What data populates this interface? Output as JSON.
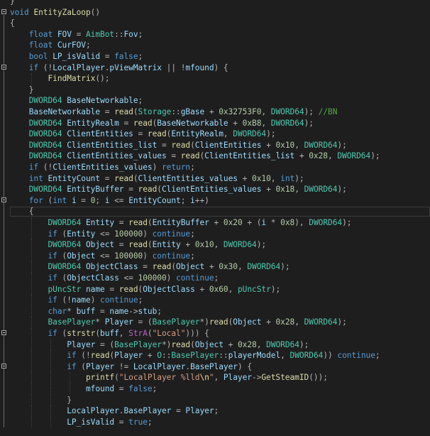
{
  "file_top_brace": "}",
  "lines": [
    [
      [
        "}",
        "op"
      ]
    ],
    [
      [
        "void",
        "kw"
      ],
      [
        " ",
        ""
      ],
      [
        "EntityZaLoop",
        "fn"
      ],
      [
        "()",
        "op"
      ]
    ],
    [
      [
        "{",
        "op"
      ]
    ],
    [
      [
        "    ",
        ""
      ],
      [
        "float",
        "kw"
      ],
      [
        " ",
        ""
      ],
      [
        "FOV",
        "vr"
      ],
      [
        " = ",
        "op"
      ],
      [
        "AimBot",
        "ty"
      ],
      [
        "::",
        "op"
      ],
      [
        "Fov",
        "vr"
      ],
      [
        ";",
        "op"
      ]
    ],
    [
      [
        "    ",
        ""
      ],
      [
        "float",
        "kw"
      ],
      [
        " ",
        ""
      ],
      [
        "CurFOV",
        "vr"
      ],
      [
        ";",
        "op"
      ]
    ],
    [
      [
        "    ",
        ""
      ],
      [
        "bool",
        "kw"
      ],
      [
        " ",
        ""
      ],
      [
        "LP_isValid",
        "vr"
      ],
      [
        " = ",
        "op"
      ],
      [
        "false",
        "kw"
      ],
      [
        ";",
        "op"
      ]
    ],
    [
      [
        "    ",
        ""
      ],
      [
        "if",
        "kw"
      ],
      [
        " (!",
        "op"
      ],
      [
        "LocalPlayer",
        "vr"
      ],
      [
        ".",
        "op"
      ],
      [
        "pViewMatrix",
        "vr"
      ],
      [
        " || !",
        "op"
      ],
      [
        "mfound",
        "vr"
      ],
      [
        ") {",
        "op"
      ]
    ],
    [
      [
        "        ",
        ""
      ],
      [
        "FindMatrix",
        "fn"
      ],
      [
        "();",
        "op"
      ]
    ],
    [
      [
        "    ",
        ""
      ],
      [
        "}",
        "op"
      ]
    ],
    [
      [
        "    ",
        ""
      ],
      [
        "DWORD64",
        "ty"
      ],
      [
        " ",
        ""
      ],
      [
        "BaseNetworkable",
        "vr"
      ],
      [
        ";",
        "op"
      ]
    ],
    [
      [
        "    ",
        ""
      ],
      [
        "BaseNetworkable",
        "vr"
      ],
      [
        " = ",
        "op"
      ],
      [
        "read",
        "fn"
      ],
      [
        "(",
        "op"
      ],
      [
        "Storage",
        "ty"
      ],
      [
        "::",
        "op"
      ],
      [
        "gBase",
        "vr"
      ],
      [
        " + ",
        "op"
      ],
      [
        "0x32753F0",
        "nm"
      ],
      [
        ", ",
        "op"
      ],
      [
        "DWORD64",
        "ty"
      ],
      [
        "); ",
        "op"
      ],
      [
        "//BN",
        "cm"
      ]
    ],
    [
      [
        "    ",
        ""
      ],
      [
        "DWORD64",
        "ty"
      ],
      [
        " ",
        ""
      ],
      [
        "EntityRealm",
        "vr"
      ],
      [
        " = ",
        "op"
      ],
      [
        "read",
        "fn"
      ],
      [
        "(",
        "op"
      ],
      [
        "BaseNetworkable",
        "vr"
      ],
      [
        " + ",
        "op"
      ],
      [
        "0xB8",
        "nm"
      ],
      [
        ", ",
        "op"
      ],
      [
        "DWORD64",
        "ty"
      ],
      [
        ");",
        "op"
      ]
    ],
    [
      [
        "    ",
        ""
      ],
      [
        "DWORD64",
        "ty"
      ],
      [
        " ",
        ""
      ],
      [
        "ClientEntities",
        "vr"
      ],
      [
        " = ",
        "op"
      ],
      [
        "read",
        "fn"
      ],
      [
        "(",
        "op"
      ],
      [
        "EntityRealm",
        "vr"
      ],
      [
        ", ",
        "op"
      ],
      [
        "DWORD64",
        "ty"
      ],
      [
        ");",
        "op"
      ]
    ],
    [
      [
        "    ",
        ""
      ],
      [
        "DWORD64",
        "ty"
      ],
      [
        " ",
        ""
      ],
      [
        "ClientEntities_list",
        "vr"
      ],
      [
        " = ",
        "op"
      ],
      [
        "read",
        "fn"
      ],
      [
        "(",
        "op"
      ],
      [
        "ClientEntities",
        "vr"
      ],
      [
        " + ",
        "op"
      ],
      [
        "0x10",
        "nm"
      ],
      [
        ", ",
        "op"
      ],
      [
        "DWORD64",
        "ty"
      ],
      [
        ");",
        "op"
      ]
    ],
    [
      [
        "    ",
        ""
      ],
      [
        "DWORD64",
        "ty"
      ],
      [
        " ",
        ""
      ],
      [
        "ClientEntities_values",
        "vr"
      ],
      [
        " = ",
        "op"
      ],
      [
        "read",
        "fn"
      ],
      [
        "(",
        "op"
      ],
      [
        "ClientEntities_list",
        "vr"
      ],
      [
        " + ",
        "op"
      ],
      [
        "0x28",
        "nm"
      ],
      [
        ", ",
        "op"
      ],
      [
        "DWORD64",
        "ty"
      ],
      [
        ");",
        "op"
      ]
    ],
    [
      [
        "    ",
        ""
      ],
      [
        "if",
        "kw"
      ],
      [
        " (!",
        "op"
      ],
      [
        "ClientEntities_values",
        "vr"
      ],
      [
        ") ",
        "op"
      ],
      [
        "return",
        "kw"
      ],
      [
        ";",
        "op"
      ]
    ],
    [
      [
        "    ",
        ""
      ],
      [
        "int",
        "kw"
      ],
      [
        " ",
        ""
      ],
      [
        "EntityCount",
        "vr"
      ],
      [
        " = ",
        "op"
      ],
      [
        "read",
        "fn"
      ],
      [
        "(",
        "op"
      ],
      [
        "ClientEntities_values",
        "vr"
      ],
      [
        " + ",
        "op"
      ],
      [
        "0x10",
        "nm"
      ],
      [
        ", ",
        "op"
      ],
      [
        "int",
        "kw"
      ],
      [
        ");",
        "op"
      ]
    ],
    [
      [
        "    ",
        ""
      ],
      [
        "DWORD64",
        "ty"
      ],
      [
        " ",
        ""
      ],
      [
        "EntityBuffer",
        "vr"
      ],
      [
        " = ",
        "op"
      ],
      [
        "read",
        "fn"
      ],
      [
        "(",
        "op"
      ],
      [
        "ClientEntities_values",
        "vr"
      ],
      [
        " + ",
        "op"
      ],
      [
        "0x18",
        "nm"
      ],
      [
        ", ",
        "op"
      ],
      [
        "DWORD64",
        "ty"
      ],
      [
        ");",
        "op"
      ]
    ],
    [
      [
        "    ",
        ""
      ],
      [
        "for",
        "kw"
      ],
      [
        " (",
        "op"
      ],
      [
        "int",
        "kw"
      ],
      [
        " ",
        ""
      ],
      [
        "i",
        "vr"
      ],
      [
        " = ",
        "op"
      ],
      [
        "0",
        "nm"
      ],
      [
        "; ",
        "op"
      ],
      [
        "i",
        "vr"
      ],
      [
        " <= ",
        "op"
      ],
      [
        "EntityCount",
        "vr"
      ],
      [
        "; ",
        "op"
      ],
      [
        "i",
        "vr"
      ],
      [
        "++)",
        "op"
      ]
    ],
    [
      [
        "    ",
        ""
      ],
      [
        "{",
        "op"
      ]
    ],
    [
      [
        "        ",
        ""
      ],
      [
        "DWORD64",
        "ty"
      ],
      [
        " ",
        ""
      ],
      [
        "Entity",
        "vr"
      ],
      [
        " = ",
        "op"
      ],
      [
        "read",
        "fn"
      ],
      [
        "(",
        "op"
      ],
      [
        "EntityBuffer",
        "vr"
      ],
      [
        " + ",
        "op"
      ],
      [
        "0x20",
        "nm"
      ],
      [
        " + (",
        "op"
      ],
      [
        "i",
        "vr"
      ],
      [
        " * ",
        "op"
      ],
      [
        "0x8",
        "nm"
      ],
      [
        "), ",
        "op"
      ],
      [
        "DWORD64",
        "ty"
      ],
      [
        ");",
        "op"
      ]
    ],
    [
      [
        "        ",
        ""
      ],
      [
        "if",
        "kw"
      ],
      [
        " (",
        "op"
      ],
      [
        "Entity",
        "vr"
      ],
      [
        " <= ",
        "op"
      ],
      [
        "100000",
        "nm"
      ],
      [
        ") ",
        "op"
      ],
      [
        "continue",
        "kw"
      ],
      [
        ";",
        "op"
      ]
    ],
    [
      [
        "        ",
        ""
      ],
      [
        "DWORD64",
        "ty"
      ],
      [
        " ",
        ""
      ],
      [
        "Object",
        "vr"
      ],
      [
        " = ",
        "op"
      ],
      [
        "read",
        "fn"
      ],
      [
        "(",
        "op"
      ],
      [
        "Entity",
        "vr"
      ],
      [
        " + ",
        "op"
      ],
      [
        "0x10",
        "nm"
      ],
      [
        ", ",
        "op"
      ],
      [
        "DWORD64",
        "ty"
      ],
      [
        ");",
        "op"
      ]
    ],
    [
      [
        "        ",
        ""
      ],
      [
        "if",
        "kw"
      ],
      [
        " (",
        "op"
      ],
      [
        "Object",
        "vr"
      ],
      [
        " <= ",
        "op"
      ],
      [
        "100000",
        "nm"
      ],
      [
        ") ",
        "op"
      ],
      [
        "continue",
        "kw"
      ],
      [
        ";",
        "op"
      ]
    ],
    [
      [
        "        ",
        ""
      ],
      [
        "DWORD64",
        "ty"
      ],
      [
        " ",
        ""
      ],
      [
        "ObjectClass",
        "vr"
      ],
      [
        " = ",
        "op"
      ],
      [
        "read",
        "fn"
      ],
      [
        "(",
        "op"
      ],
      [
        "Object",
        "vr"
      ],
      [
        " + ",
        "op"
      ],
      [
        "0x30",
        "nm"
      ],
      [
        ", ",
        "op"
      ],
      [
        "DWORD64",
        "ty"
      ],
      [
        ");",
        "op"
      ]
    ],
    [
      [
        "        ",
        ""
      ],
      [
        "if",
        "kw"
      ],
      [
        " (",
        "op"
      ],
      [
        "ObjectClass",
        "vr"
      ],
      [
        " <= ",
        "op"
      ],
      [
        "100000",
        "nm"
      ],
      [
        ") ",
        "op"
      ],
      [
        "continue",
        "kw"
      ],
      [
        ";",
        "op"
      ]
    ],
    [
      [
        "        ",
        ""
      ],
      [
        "pUncStr",
        "ty"
      ],
      [
        " ",
        ""
      ],
      [
        "name",
        "vr"
      ],
      [
        " = ",
        "op"
      ],
      [
        "read",
        "fn"
      ],
      [
        "(",
        "op"
      ],
      [
        "ObjectClass",
        "vr"
      ],
      [
        " + ",
        "op"
      ],
      [
        "0x60",
        "nm"
      ],
      [
        ", ",
        "op"
      ],
      [
        "pUncStr",
        "ty"
      ],
      [
        ");",
        "op"
      ]
    ],
    [
      [
        "        ",
        ""
      ],
      [
        "if",
        "kw"
      ],
      [
        " (!",
        "op"
      ],
      [
        "name",
        "vr"
      ],
      [
        ") ",
        "op"
      ],
      [
        "continue",
        "kw"
      ],
      [
        ";",
        "op"
      ]
    ],
    [
      [
        "        ",
        ""
      ],
      [
        "char",
        "kw"
      ],
      [
        "* ",
        "op"
      ],
      [
        "buff",
        "vr"
      ],
      [
        " = ",
        "op"
      ],
      [
        "name",
        "vr"
      ],
      [
        "->",
        "op"
      ],
      [
        "stub",
        "vr"
      ],
      [
        ";",
        "op"
      ]
    ],
    [
      [
        "        ",
        ""
      ],
      [
        "BasePlayer",
        "ty"
      ],
      [
        "* ",
        "op"
      ],
      [
        "Player",
        "vr"
      ],
      [
        " = (",
        "op"
      ],
      [
        "BasePlayer",
        "ty"
      ],
      [
        "*)",
        "op"
      ],
      [
        "read",
        "fn"
      ],
      [
        "(",
        "op"
      ],
      [
        "Object",
        "vr"
      ],
      [
        " + ",
        "op"
      ],
      [
        "0x28",
        "nm"
      ],
      [
        ", ",
        "op"
      ],
      [
        "DWORD64",
        "ty"
      ],
      [
        ");",
        "op"
      ]
    ],
    [
      [
        "        ",
        ""
      ],
      [
        "if",
        "kw"
      ],
      [
        " (",
        "op"
      ],
      [
        "strstr",
        "fn"
      ],
      [
        "(",
        "op"
      ],
      [
        "buff",
        "vr"
      ],
      [
        ", ",
        "op"
      ],
      [
        "StrA",
        "mc"
      ],
      [
        "(",
        "op"
      ],
      [
        "\"Local\"",
        "st"
      ],
      [
        "))) {",
        "op"
      ]
    ],
    [
      [
        "            ",
        ""
      ],
      [
        "Player",
        "vr"
      ],
      [
        " = (",
        "op"
      ],
      [
        "BasePlayer",
        "ty"
      ],
      [
        "*)",
        "op"
      ],
      [
        "read",
        "fn"
      ],
      [
        "(",
        "op"
      ],
      [
        "Object",
        "vr"
      ],
      [
        " + ",
        "op"
      ],
      [
        "0x28",
        "nm"
      ],
      [
        ", ",
        "op"
      ],
      [
        "DWORD64",
        "ty"
      ],
      [
        ");",
        "op"
      ]
    ],
    [
      [
        "            ",
        ""
      ],
      [
        "if",
        "kw"
      ],
      [
        " (!",
        "op"
      ],
      [
        "read",
        "fn"
      ],
      [
        "(",
        "op"
      ],
      [
        "Player",
        "vr"
      ],
      [
        " + ",
        "op"
      ],
      [
        "O",
        "ty"
      ],
      [
        "::",
        "op"
      ],
      [
        "BasePlayer",
        "ty"
      ],
      [
        "::",
        "op"
      ],
      [
        "playerModel",
        "vr"
      ],
      [
        ", ",
        "op"
      ],
      [
        "DWORD64",
        "ty"
      ],
      [
        ")) ",
        "op"
      ],
      [
        "continue",
        "kw"
      ],
      [
        ";",
        "op"
      ]
    ],
    [
      [
        "            ",
        ""
      ],
      [
        "if",
        "kw"
      ],
      [
        " (",
        "op"
      ],
      [
        "Player",
        "vr"
      ],
      [
        " != ",
        "op"
      ],
      [
        "LocalPlayer",
        "vr"
      ],
      [
        ".",
        "op"
      ],
      [
        "BasePlayer",
        "vr"
      ],
      [
        ") {",
        "op"
      ]
    ],
    [
      [
        "                ",
        ""
      ],
      [
        "printf",
        "fn"
      ],
      [
        "(",
        "op"
      ],
      [
        "\"LocalPlayer %lld",
        "st"
      ],
      [
        "\\n",
        "es"
      ],
      [
        "\"",
        "st"
      ],
      [
        ", ",
        "op"
      ],
      [
        "Player",
        "vr"
      ],
      [
        "->",
        "op"
      ],
      [
        "GetSteamID",
        "fn"
      ],
      [
        "());",
        "op"
      ]
    ],
    [
      [
        "                ",
        ""
      ],
      [
        "mfound",
        "vr"
      ],
      [
        " = ",
        "op"
      ],
      [
        "false",
        "kw"
      ],
      [
        ";",
        "op"
      ]
    ],
    [
      [
        "            ",
        ""
      ],
      [
        "}",
        "op"
      ]
    ],
    [
      [
        "            ",
        ""
      ],
      [
        "LocalPlayer",
        "vr"
      ],
      [
        ".",
        "op"
      ],
      [
        "BasePlayer",
        "vr"
      ],
      [
        " = ",
        "op"
      ],
      [
        "Player",
        "vr"
      ],
      [
        ";",
        "op"
      ]
    ],
    [
      [
        "            ",
        ""
      ],
      [
        "LP_isValid",
        "vr"
      ],
      [
        " = ",
        "op"
      ],
      [
        "true",
        "kw"
      ],
      [
        ";",
        "op"
      ]
    ]
  ],
  "folds": [
    1,
    6,
    18,
    30,
    33
  ],
  "fold_symbol": "−"
}
